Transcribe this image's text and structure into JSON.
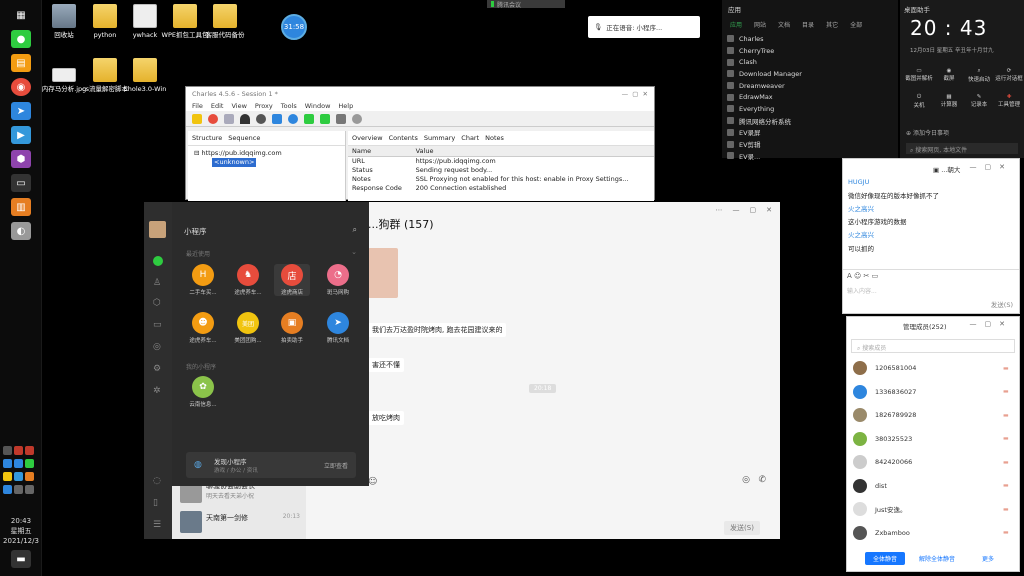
{
  "desktop": {
    "icons": [
      {
        "label": "回收站",
        "type": "bin"
      },
      {
        "label": "python",
        "type": "folder"
      },
      {
        "label": "ywhack",
        "type": "file"
      },
      {
        "label": "WPE抓包工具包",
        "type": "folder"
      },
      {
        "label": "客服代码备份",
        "type": "folder"
      },
      {
        "label": "内存马分析.jpg",
        "type": "file"
      },
      {
        "label": "cs流量解密脚本",
        "type": "folder"
      },
      {
        "label": "Ehole3.0-Win",
        "type": "folder"
      }
    ],
    "float_timer": "31:58"
  },
  "taskbar": {
    "time": "20:43",
    "weekday": "星期五",
    "date": "2021/12/3"
  },
  "meeting_bar": {
    "label": "腾讯会议"
  },
  "voice": {
    "text": "正在语音: 小程序..."
  },
  "charles": {
    "title": "Charles 4.5.6 - Session 1 *",
    "menus": [
      "File",
      "Edit",
      "View",
      "Proxy",
      "Tools",
      "Window",
      "Help"
    ],
    "left_tabs": [
      "Structure",
      "Sequence"
    ],
    "tree_host": "https://pub.idqqimg.com",
    "tree_child": "<unknown>",
    "right_tabs": [
      "Overview",
      "Contents",
      "Summary",
      "Chart",
      "Notes"
    ],
    "table_headers": [
      "Name",
      "Value"
    ],
    "rows": [
      {
        "name": "URL",
        "value": "https://pub.idqqimg.com"
      },
      {
        "name": "Status",
        "value": "Sending request body..."
      },
      {
        "name": "Notes",
        "value": "SSL Proxying not enabled for this host: enable in Proxy Settings..."
      },
      {
        "name": "Response Code",
        "value": "200 Connection established"
      }
    ]
  },
  "wechat": {
    "chat_title": "...狗群 (157)",
    "messages": [
      {
        "text": "我们去万达盈时院烤肉, 跑去花园建议来的"
      },
      {
        "text": "害还不懂"
      },
      {
        "text": "放吃烤肉"
      }
    ],
    "time_tag": "20:18",
    "send_label": "发送(S)",
    "list": [
      {
        "name": "聊骚协会副会长",
        "preview": "明天去看天弟小祝",
        "time": ""
      },
      {
        "name": "天南第一剑修",
        "preview": "",
        "time": "20:13"
      }
    ]
  },
  "mini_program": {
    "title": "小程序",
    "recent_label": "最近使用",
    "mine_label": "我的小程序",
    "apps": [
      {
        "label": "二手车买...",
        "color": "#f39c12",
        "glyph": "H"
      },
      {
        "label": "途虎养车...",
        "color": "#e74c3c",
        "glyph": "♞"
      },
      {
        "label": "途虎商店",
        "color": "#e74c3c",
        "glyph": "店"
      },
      {
        "label": "斑马网购",
        "color": "#ec6e8a",
        "glyph": "◔"
      },
      {
        "label": "途虎养车...",
        "color": "#f39c12",
        "glyph": "☻"
      },
      {
        "label": "美团团购...",
        "color": "#f1c40f",
        "glyph": "美团"
      },
      {
        "label": "拍卖助手",
        "color": "#e67e22",
        "glyph": "▣"
      },
      {
        "label": "腾讯文档",
        "color": "#2e86de",
        "glyph": "➤"
      }
    ],
    "my_app": {
      "label": "云南信息...",
      "color": "#8bc34a",
      "glyph": "✿"
    },
    "find": {
      "title": "发现小程序",
      "sub": "游戏 / 办公 / 资讯",
      "action": "立即查看"
    }
  },
  "applist": {
    "tabs": [
      "应用",
      "网站",
      "文档",
      "目录",
      "其它",
      "全部"
    ],
    "items": [
      "Charles",
      "CherryTree",
      "Clash",
      "Download Manager",
      "Dreamweaver",
      "EdrawMax",
      "Everything",
      "腾讯网络分析系统",
      "EV录屏",
      "EV剪辑",
      "EV录..."
    ]
  },
  "notif": {
    "title": "桌面助手",
    "time": "20 : 43",
    "date": "12月03日  星期五  辛丑年十月廿九",
    "actions": [
      "截图并解析",
      "截屏",
      "快速启动",
      "运行对话框",
      "关机",
      "计算器",
      "记录本",
      "工具管理"
    ],
    "todo": "添加今日事项",
    "search": "搜索网页, 本地文件"
  },
  "small_chat": {
    "title": "...朝大",
    "lines": [
      {
        "text": "HUGJU",
        "color": "#2e86de"
      },
      {
        "text": "微信好像现在的版本好像抓不了",
        "color": "#222"
      },
      {
        "text": "火之高兴",
        "color": "#2e86de"
      },
      {
        "text": "这小程序游戏的数据",
        "color": "#222"
      },
      {
        "text": "火之高兴",
        "color": "#2e86de"
      },
      {
        "text": "可以抓的",
        "color": "#222"
      }
    ],
    "input_placeholder": "输入内容...",
    "send": "发送(S)"
  },
  "members": {
    "title": "管理成员(252)",
    "search_placeholder": "搜索成员",
    "rows": [
      {
        "name": "1206581004",
        "color": "#8e6e4a"
      },
      {
        "name": "1336836027",
        "color": "#2e86de"
      },
      {
        "name": "1826789928",
        "color": "#9a8a6a"
      },
      {
        "name": "380325523",
        "color": "#7cb342"
      },
      {
        "name": "842420066",
        "color": "#ccc"
      },
      {
        "name": "dist",
        "color": "#333"
      },
      {
        "name": "Just安逸。",
        "color": "#ddd"
      },
      {
        "name": "Zxbamboo",
        "color": "#555"
      }
    ],
    "btn_all": "全体静音",
    "btn_unmute": "解除全体静音",
    "btn_more": "更多"
  }
}
